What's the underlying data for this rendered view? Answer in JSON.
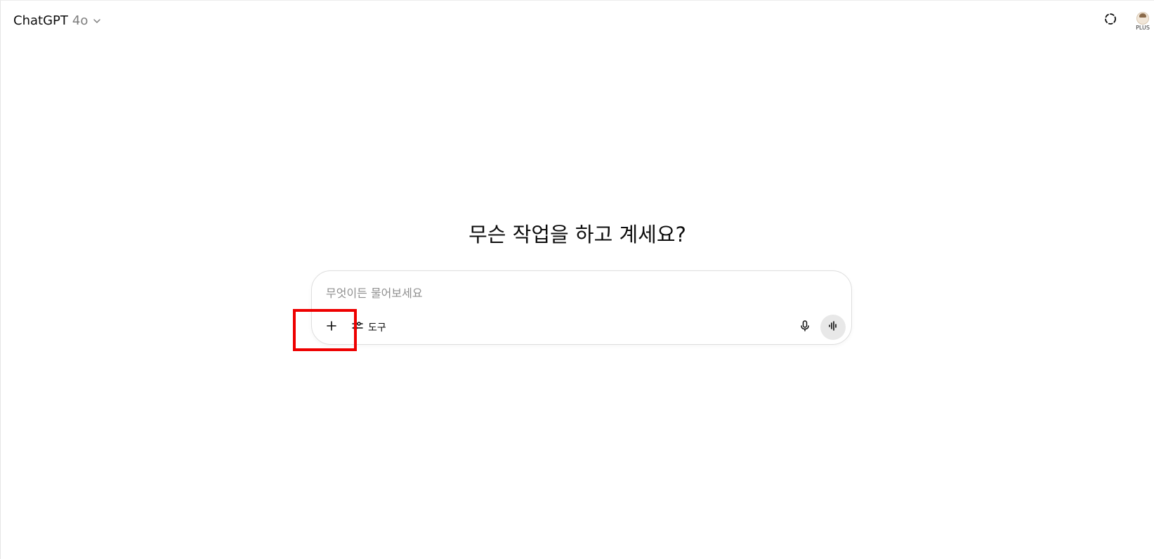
{
  "header": {
    "model_name": "ChatGPT",
    "model_version": "4o",
    "chevron_icon": "chevron-down-icon",
    "temp_chat_icon": "dashed-circle-icon",
    "avatar_badge": "PLUS"
  },
  "main": {
    "heading": "무슨 작업을 하고 계세요?",
    "composer": {
      "placeholder": "무엇이든 물어보세요",
      "value": "",
      "attach_icon": "plus-icon",
      "tools_icon": "tools-sliders-icon",
      "tools_label": "도구",
      "mic_icon": "microphone-icon",
      "voice_icon": "voice-waveform-icon"
    }
  },
  "annotation": {
    "color": "#ee0000"
  }
}
